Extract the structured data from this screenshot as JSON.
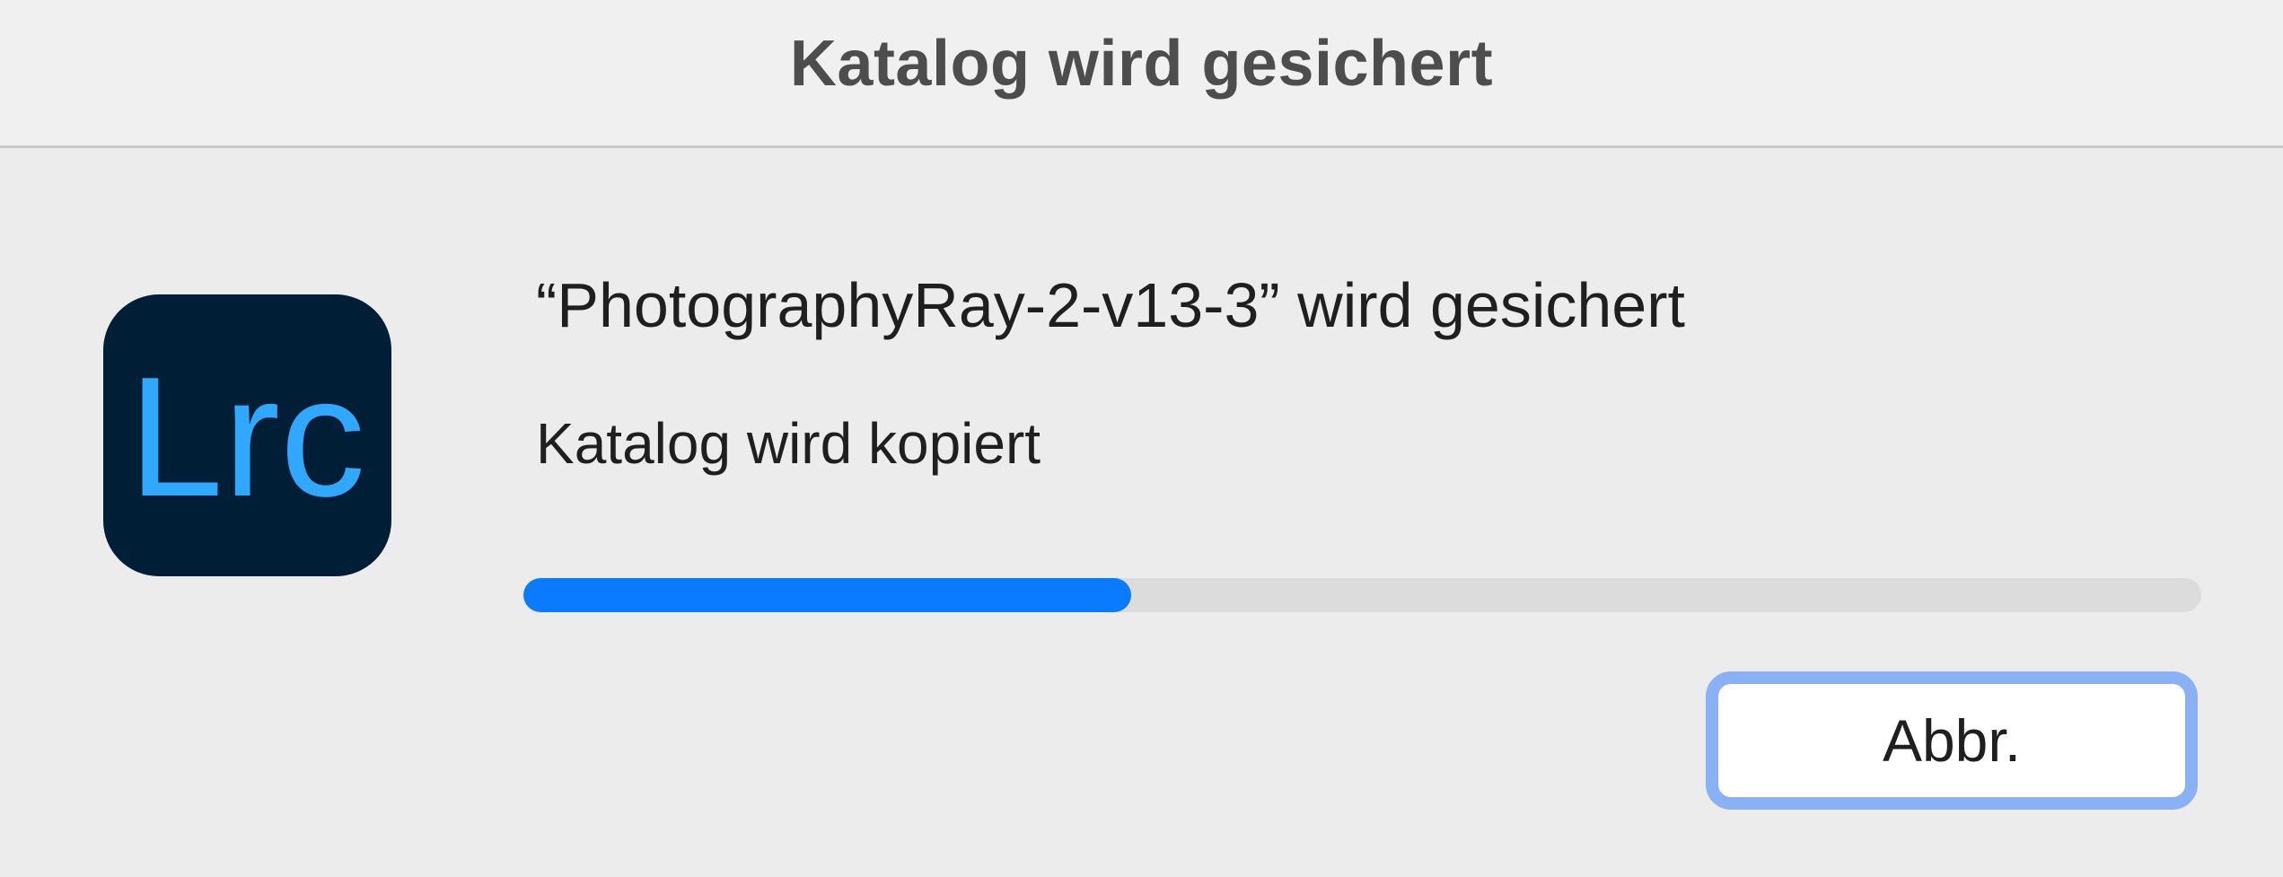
{
  "window": {
    "title": "Katalog wird gesichert"
  },
  "app_icon": {
    "name": "lightroom-classic-icon",
    "text": "Lrc",
    "background": "#001e36",
    "foreground": "#31a8ff"
  },
  "main": {
    "heading": "“PhotographyRay-2-v13-3” wird gesichert",
    "status": "Katalog wird kopiert"
  },
  "progress": {
    "fraction": 0.362,
    "color": "#0a7aff"
  },
  "buttons": {
    "cancel_label": "Abbr."
  }
}
